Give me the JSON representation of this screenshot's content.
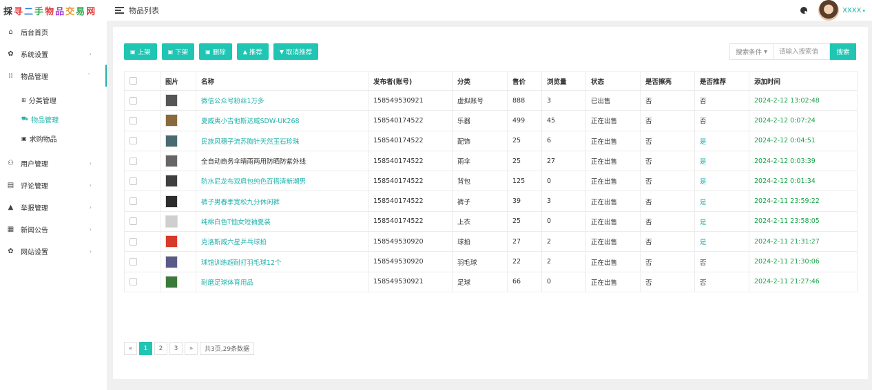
{
  "logo": {
    "chars": [
      "採",
      "寻",
      "二",
      "手",
      "物",
      "品",
      "交",
      "易",
      "网"
    ]
  },
  "header": {
    "title": "物品列表",
    "user": "XXXX"
  },
  "sidebar": {
    "items": [
      {
        "label": "后台首页",
        "icon": "home-icon",
        "glyph": "⌂"
      },
      {
        "label": "系统设置",
        "icon": "gear-icon",
        "glyph": "✿",
        "arrow": "›"
      },
      {
        "label": "物品管理",
        "icon": "grid-icon",
        "glyph": "⁞⁞",
        "arrow": "ˇ"
      }
    ],
    "sub": [
      {
        "label": "分类管理",
        "icon": "grid-small-icon",
        "glyph": "⊞"
      },
      {
        "label": "物品管理",
        "icon": "cart-icon",
        "glyph": "⛟"
      },
      {
        "label": "求购物品",
        "icon": "card-icon",
        "glyph": "▣"
      }
    ],
    "items2": [
      {
        "label": "用户管理",
        "icon": "users-icon",
        "glyph": "⚇",
        "arrow": "›"
      },
      {
        "label": "评论管理",
        "icon": "comment-icon",
        "glyph": "▤",
        "arrow": "›"
      },
      {
        "label": "举报管理",
        "icon": "warning-icon",
        "glyph": "▲",
        "arrow": "›"
      },
      {
        "label": "新闻公告",
        "icon": "news-icon",
        "glyph": "▦",
        "arrow": "›"
      },
      {
        "label": "网站设置",
        "icon": "settings-icon",
        "glyph": "✿",
        "arrow": "›"
      }
    ]
  },
  "toolbar": {
    "buttons": [
      {
        "label": "上架",
        "glyph": "▣"
      },
      {
        "label": "下架",
        "glyph": "▣"
      },
      {
        "label": "删除",
        "glyph": "▣"
      },
      {
        "label": "推荐",
        "glyph": "▲"
      },
      {
        "label": "取消推荐",
        "glyph": "▼"
      }
    ]
  },
  "search": {
    "condition": "搜索条件",
    "placeholder": "请输入搜索值",
    "button": "搜索"
  },
  "table": {
    "columns": [
      "",
      "图片",
      "名称",
      "发布者(账号)",
      "分类",
      "售价",
      "浏览量",
      "状态",
      "是否擦亮",
      "是否推荐",
      "添加时间"
    ],
    "rows": [
      {
        "thumb": "#555",
        "name": "微信公众号粉丝1万多",
        "link": true,
        "publisher": "158549530921",
        "category": "虚拟账号",
        "price": "888",
        "views": "3",
        "status": "已出售",
        "polished": "否",
        "recommended": "否",
        "yes": false,
        "time": "2024-2-12 13:02:48"
      },
      {
        "thumb": "#8a6a3c",
        "name": "夏威夷小吉他斯达威SDW-UK268",
        "link": true,
        "publisher": "158540174522",
        "category": "乐器",
        "price": "499",
        "views": "45",
        "status": "正在出售",
        "polished": "否",
        "recommended": "否",
        "yes": false,
        "time": "2024-2-12 0:07:24"
      },
      {
        "thumb": "#4a6a72",
        "name": "民族风穗子流苏胸针天然玉石珍珠",
        "link": true,
        "publisher": "158540174522",
        "category": "配饰",
        "price": "25",
        "views": "6",
        "status": "正在出售",
        "polished": "否",
        "recommended": "是",
        "yes": true,
        "time": "2024-2-12 0:04:51"
      },
      {
        "thumb": "#666",
        "name": "全自动商务伞晴雨两用防晒防紫外线",
        "link": false,
        "publisher": "158540174522",
        "category": "雨伞",
        "price": "25",
        "views": "27",
        "status": "正在出售",
        "polished": "否",
        "recommended": "是",
        "yes": true,
        "time": "2024-2-12 0:03:39"
      },
      {
        "thumb": "#3f3f3f",
        "name": "防水尼龙布双肩包纯色百搭清新潮男",
        "link": true,
        "publisher": "158540174522",
        "category": "背包",
        "price": "125",
        "views": "0",
        "status": "正在出售",
        "polished": "否",
        "recommended": "是",
        "yes": true,
        "time": "2024-2-12 0:01:34"
      },
      {
        "thumb": "#2c2c2c",
        "name": "裤子男春季宽松九分休闲裤",
        "link": true,
        "publisher": "158540174522",
        "category": "裤子",
        "price": "39",
        "views": "3",
        "status": "正在出售",
        "polished": "否",
        "recommended": "是",
        "yes": true,
        "time": "2024-2-11 23:59:22"
      },
      {
        "thumb": "#cfcfcf",
        "name": "纯棉白色T恤女短袖夏装",
        "link": true,
        "publisher": "158540174522",
        "category": "上衣",
        "price": "25",
        "views": "0",
        "status": "正在出售",
        "polished": "否",
        "recommended": "是",
        "yes": true,
        "time": "2024-2-11 23:58:05"
      },
      {
        "thumb": "#d63a2a",
        "name": "克洛斯威六星乒乓球拍",
        "link": true,
        "publisher": "158549530920",
        "category": "球拍",
        "price": "27",
        "views": "2",
        "status": "正在出售",
        "polished": "否",
        "recommended": "是",
        "yes": true,
        "time": "2024-2-11 21:31:27"
      },
      {
        "thumb": "#5a5a8a",
        "name": "球馆训练超耐打羽毛球12个",
        "link": true,
        "publisher": "158549530920",
        "category": "羽毛球",
        "price": "22",
        "views": "2",
        "status": "正在出售",
        "polished": "否",
        "recommended": "否",
        "yes": false,
        "time": "2024-2-11 21:30:06"
      },
      {
        "thumb": "#3a7a3a",
        "name": "耐磨足球体育用品",
        "link": true,
        "publisher": "158549530921",
        "category": "足球",
        "price": "66",
        "views": "0",
        "status": "正在出售",
        "polished": "否",
        "recommended": "否",
        "yes": false,
        "time": "2024-2-11 21:27:46"
      }
    ]
  },
  "pager": {
    "prev": "«",
    "pages": [
      "1",
      "2",
      "3"
    ],
    "next": "»",
    "info": "共3页,29条数据"
  },
  "colors": {
    "accent": "#20c5b3",
    "link": "#20b2aa",
    "date": "#1aa34a"
  }
}
